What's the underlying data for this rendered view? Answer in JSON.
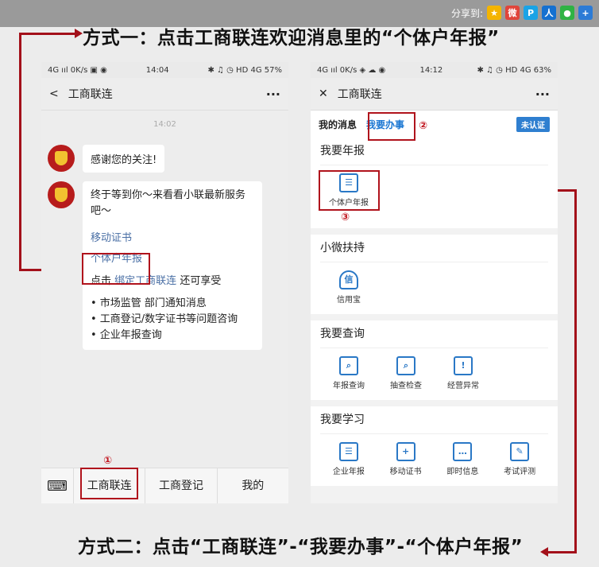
{
  "share": {
    "label": "分享到:",
    "icons": [
      "qzone-icon",
      "weibo-icon",
      "qq-icon",
      "renren-icon",
      "wechat-icon",
      "more-share-icon"
    ]
  },
  "headings": {
    "method1": "方式一：点击工商联连欢迎消息里的“个体户年报”",
    "method2": "方式二：点击“工商联连”-“我要办事”-“个体户年报”"
  },
  "phone1": {
    "status": {
      "left": "4G ııl 0K/s ▣ ◉",
      "time": "14:04",
      "right": "✱ ♫ ◷ HD 4G 57%"
    },
    "nav": {
      "back": "<",
      "title": "工商联连",
      "more": "···"
    },
    "timestamp": "14:02",
    "msg1": "感谢您的关注!",
    "msg2": {
      "line1": "终于等到你～来看看小联最新服务吧～",
      "link1": "移动证书",
      "link2": "个体户年报",
      "line2a": "点击",
      "line2b": "绑定工商联连",
      "line2c": "还可享受",
      "bullets": [
        "• 市场监管 部门通知消息",
        "• 工商登记/数字证书等问题咨询",
        "• 企业年报查询"
      ]
    },
    "bottom": {
      "menus": [
        "工商联连",
        "工商登记",
        "我的"
      ]
    }
  },
  "phone2": {
    "status": {
      "left": "4G ııl 0K/s ◈ ☁ ◉",
      "time": "14:12",
      "right": "✱ ♫ ◷ HD 4G 63%"
    },
    "nav": {
      "close": "✕",
      "title": "工商联连",
      "more": "···"
    },
    "tabs": {
      "mine": "我的消息",
      "todo": "我要办事",
      "cert": "未认证"
    },
    "sections": {
      "annual": {
        "title": "我要年报",
        "items": [
          "个体户年报"
        ]
      },
      "support": {
        "title": "小微扶持",
        "items": [
          "信用宝"
        ]
      },
      "query": {
        "title": "我要查询",
        "items": [
          "年报查询",
          "抽查检查",
          "经营异常"
        ]
      },
      "learn": {
        "title": "我要学习",
        "items": [
          "企业年报",
          "移动证书",
          "即时信息",
          "考试评测"
        ]
      }
    }
  },
  "markers": {
    "m1": "①",
    "m2": "②",
    "m3": "③"
  }
}
